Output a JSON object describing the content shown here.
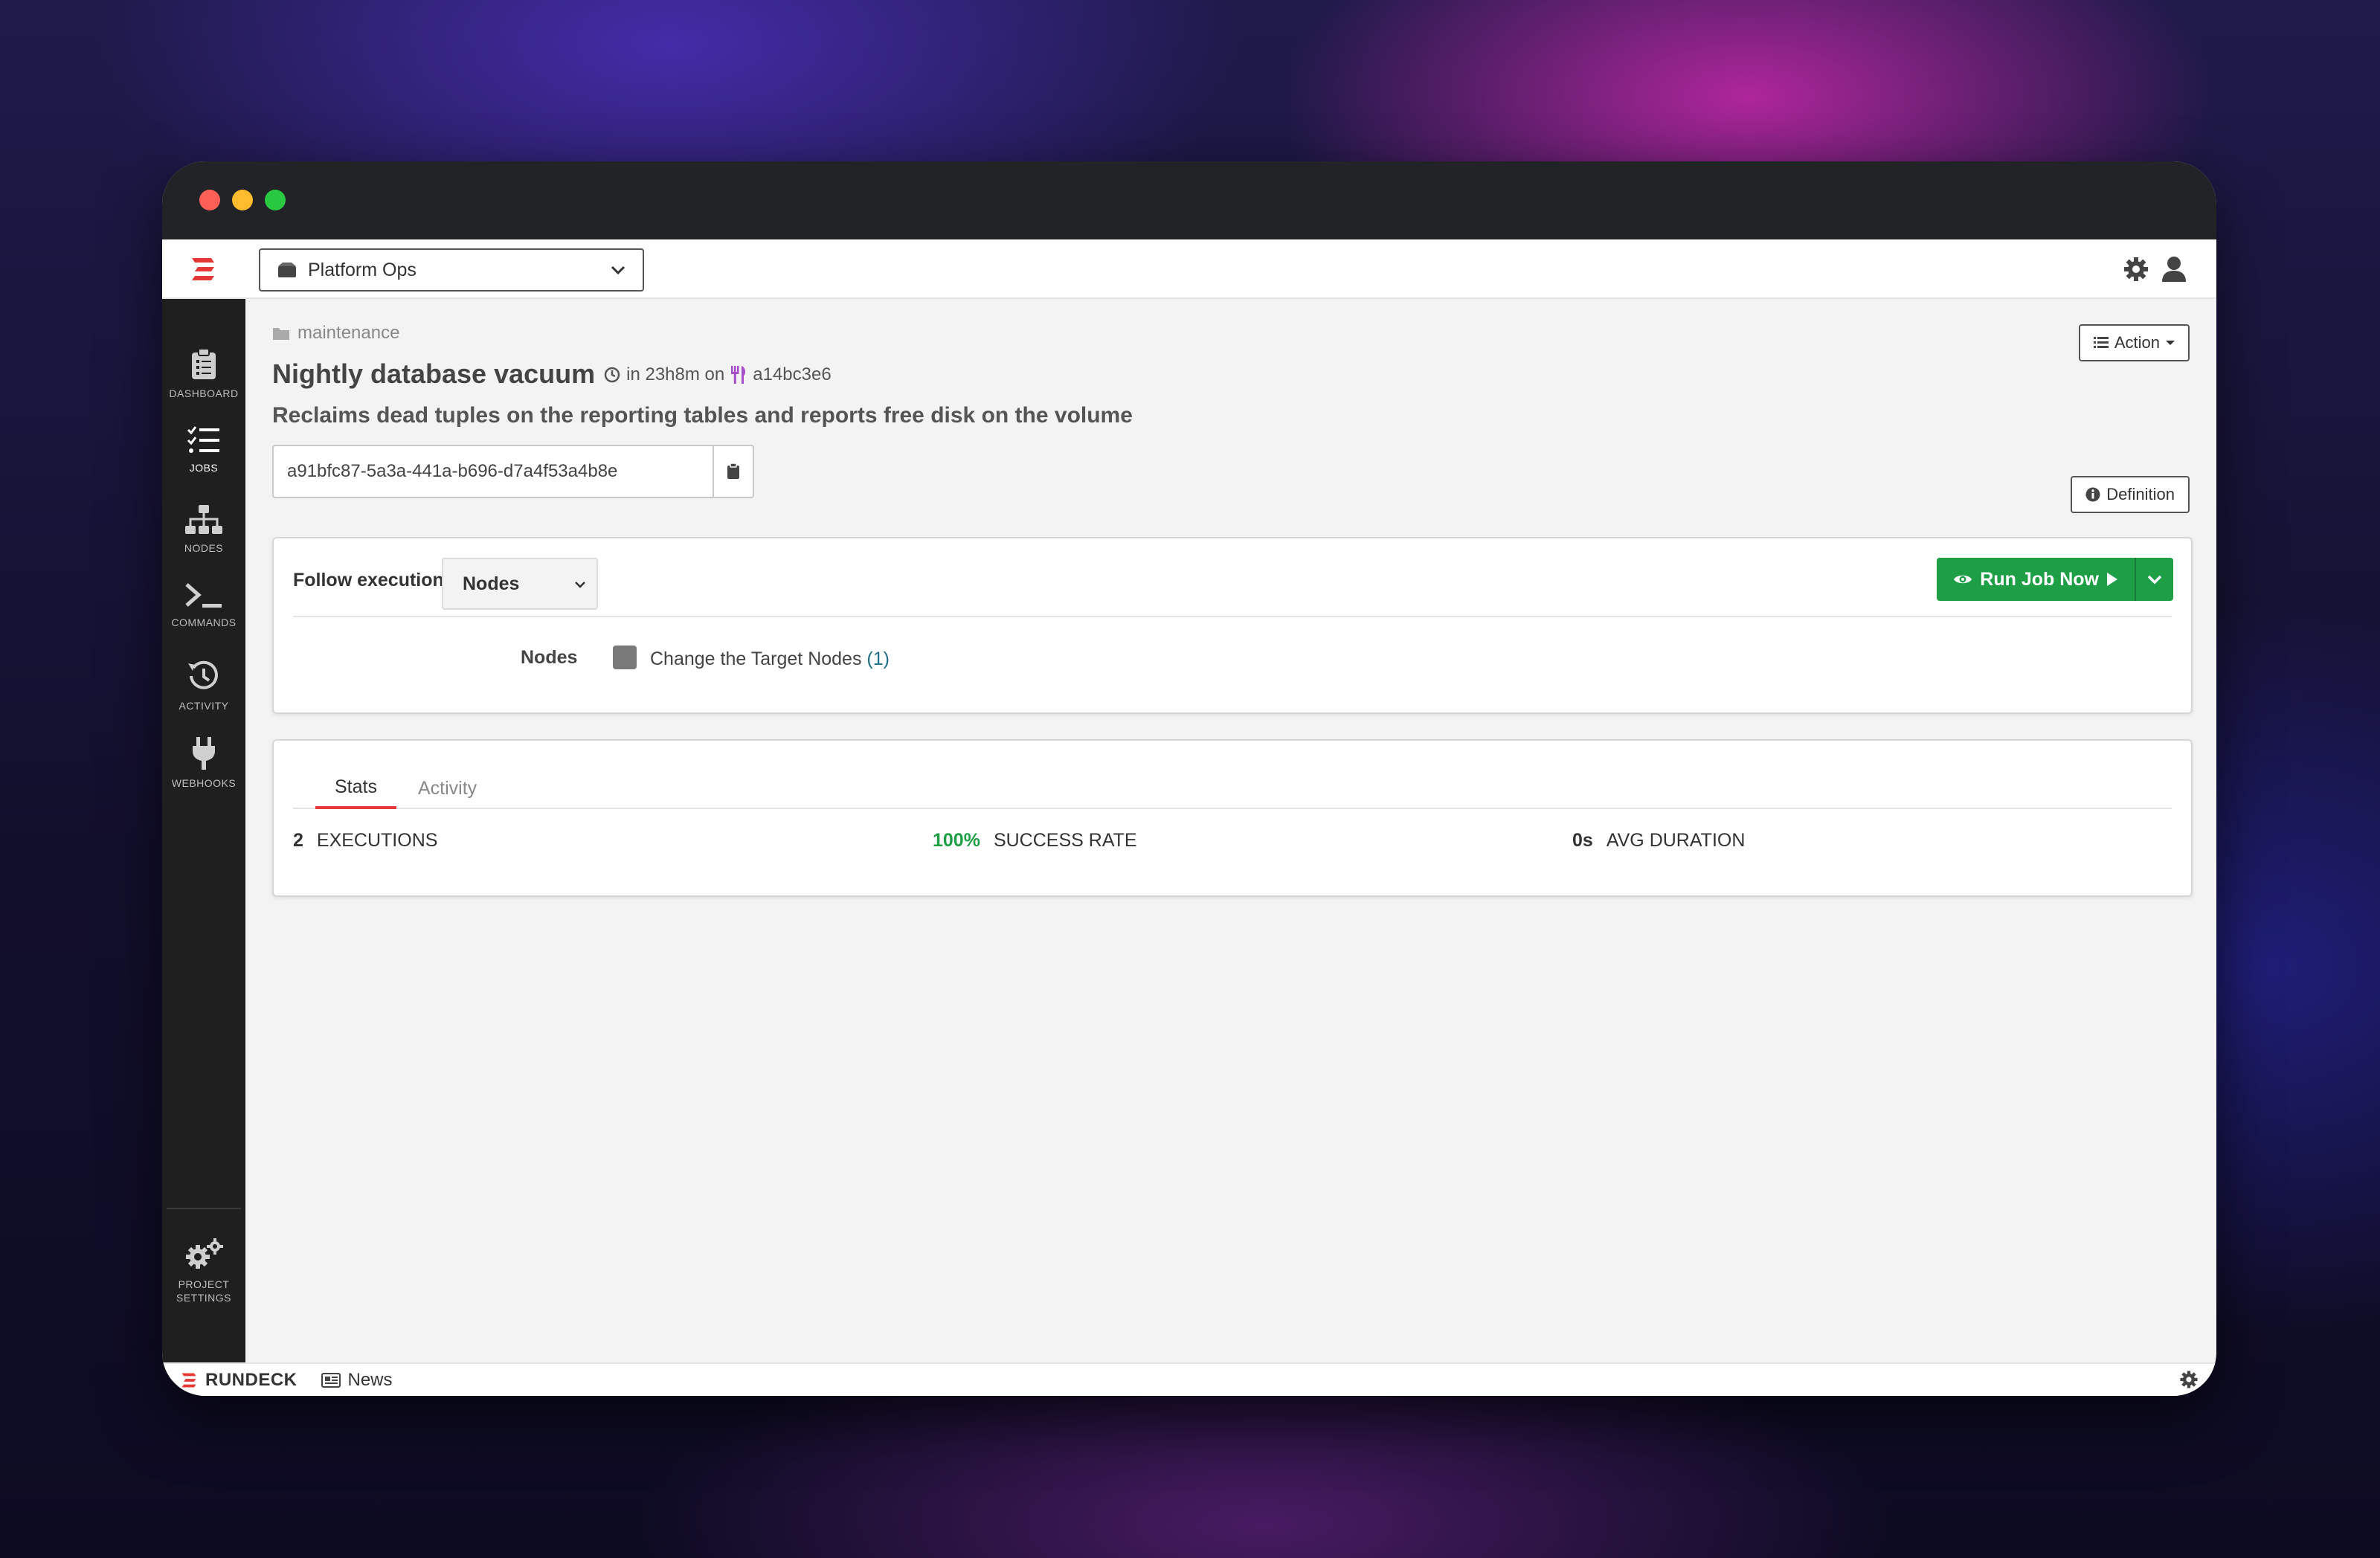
{
  "app": {
    "footer_brand": "RUNDECK",
    "footer_news": "News"
  },
  "topnav": {
    "project": "Platform Ops"
  },
  "sidebar": {
    "items": [
      {
        "label": "DASHBOARD"
      },
      {
        "label": "JOBS"
      },
      {
        "label": "NODES"
      },
      {
        "label": "COMMANDS"
      },
      {
        "label": "ACTIVITY"
      },
      {
        "label": "WEBHOOKS"
      }
    ],
    "settings_line1": "PROJECT",
    "settings_line2": "SETTINGS"
  },
  "job": {
    "group": "maintenance",
    "name": "Nightly database vacuum",
    "schedule_text": "in 23h8m on",
    "node": "a14bc3e6",
    "description": "Reclaims dead tuples on the reporting tables and reports free disk on the volume",
    "uuid": "a91bfc87-5a3a-441a-b696-d7a4f53a4b8e"
  },
  "buttons": {
    "action": "Action",
    "definition": "Definition",
    "run": "Run Job Now"
  },
  "run_panel": {
    "follow_label": "Follow execution",
    "follow_value": "Nodes",
    "nodes_label": "Nodes",
    "change_nodes": "Change the Target Nodes",
    "node_count": "(1)"
  },
  "stats": {
    "tabs": [
      "Stats",
      "Activity"
    ],
    "executions_value": "2",
    "executions_label": "EXECUTIONS",
    "success_value": "100%",
    "success_label": "SUCCESS RATE",
    "duration_value": "0s",
    "duration_label": "AVG DURATION"
  },
  "colors": {
    "accent_green": "#1e9f46",
    "brand_red": "#e53935",
    "link_teal": "#1f6f8b"
  }
}
